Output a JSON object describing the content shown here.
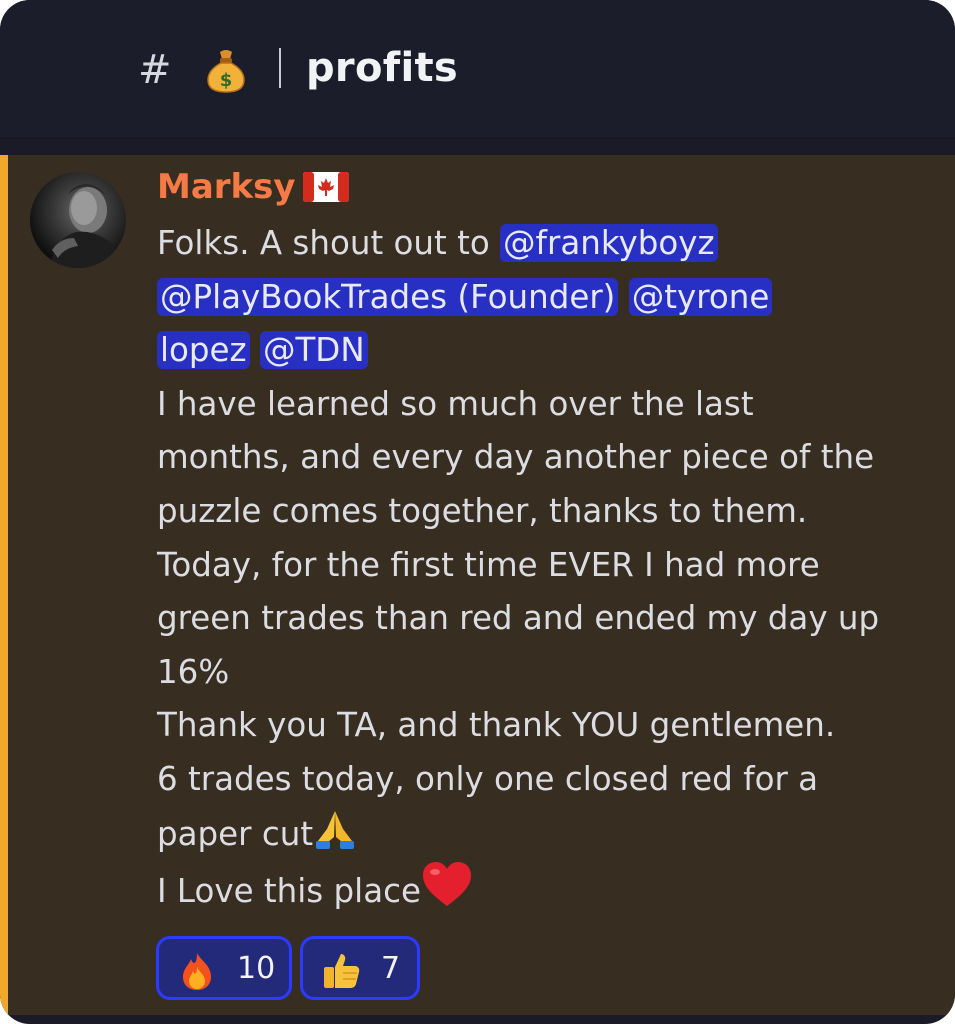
{
  "header": {
    "hash": "#",
    "channel_icon": "money-bag-icon",
    "channel_name": "profits"
  },
  "message": {
    "author": "Marksy",
    "author_color": "#f47b45",
    "author_flag": "canada-flag-icon",
    "mention_highlight_color": "#f0a929",
    "lines": [
      {
        "text": "Folks. A shout out to ",
        "mention": "@frankyboyz"
      },
      {
        "mention": "@PlayBookTrades (Founder)",
        "mention2": "@tyrone"
      },
      {
        "mention": "lopez",
        "mention2": "@TDN"
      },
      {
        "text": "I have learned so much over the last"
      },
      {
        "text": "months, and every day another piece of the"
      },
      {
        "text": "puzzle comes together, thanks to them."
      },
      {
        "text": "Today, for the first time EVER I had more"
      },
      {
        "text": "green trades than red and ended my day up"
      },
      {
        "text": "16%"
      },
      {
        "text": "Thank you TA, and thank YOU gentlemen."
      },
      {
        "text": "6 trades today, only one closed red for a"
      },
      {
        "text": "paper cut",
        "emoji": "folded-hands-icon"
      },
      {
        "text": "I Love this place",
        "emoji": "red-heart-icon"
      }
    ]
  },
  "reactions": [
    {
      "emoji": "fire-icon",
      "count": "10"
    },
    {
      "emoji": "thumbs-up-icon",
      "count": "7"
    }
  ]
}
